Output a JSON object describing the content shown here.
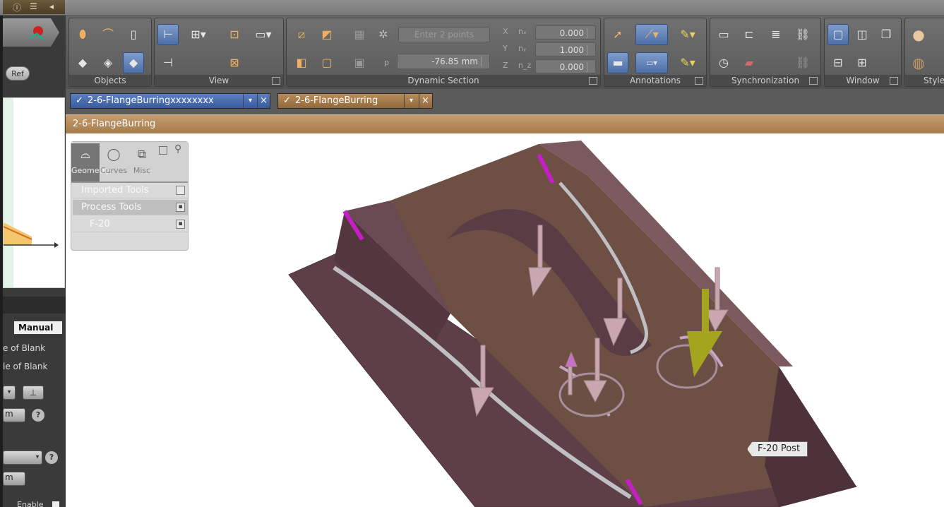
{
  "left_panel": {
    "ref_button": "Ref",
    "mode_label": "Manual",
    "line1": "e of Blank",
    "line2": "le of Blank",
    "unit1": "m",
    "unit2": "m",
    "enable_label": "Enable",
    "help": "?"
  },
  "ribbon": {
    "groups": {
      "objects": "Objects",
      "view": "View",
      "dynamic_section": "Dynamic Section",
      "annotations": "Annotations",
      "synchronization": "Synchronization",
      "window": "Window",
      "style": "Style"
    },
    "dynamic_section": {
      "enter_points_placeholder": "Enter 2 points",
      "p_label": "p",
      "p_value": "-76.85 mm",
      "x_label": "X",
      "y_label": "Y",
      "z_label": "Z",
      "nx_label": "nₓ",
      "ny_label": "nᵧ",
      "nz_label": "n_z",
      "nx_value": "0.000",
      "ny_value": "1.000",
      "nz_value": "0.000"
    }
  },
  "doc_tabs": [
    {
      "label": "2-6-FlangeBurringxxxxxxxx",
      "check": "✓",
      "close": "×",
      "dropdown": "▾"
    },
    {
      "label": "2-6-FlangeBurring",
      "check": "✓",
      "close": "×",
      "dropdown": "▾"
    }
  ],
  "document_title": "2-6-FlangeBurring",
  "tool_panel": {
    "tabs": [
      "Geometry",
      "Curves",
      "Misc"
    ],
    "rows": [
      "Imported Tools",
      "Process Tools",
      "F-20"
    ]
  },
  "viewport": {
    "callout": "F-20 Post"
  },
  "colors": {
    "part": "#6e4a56",
    "edge_highlight": "#c41ec4",
    "selected_tool": "#a3a51f",
    "arrow": "#c9a7ae",
    "docbar": "#b48a5b"
  }
}
